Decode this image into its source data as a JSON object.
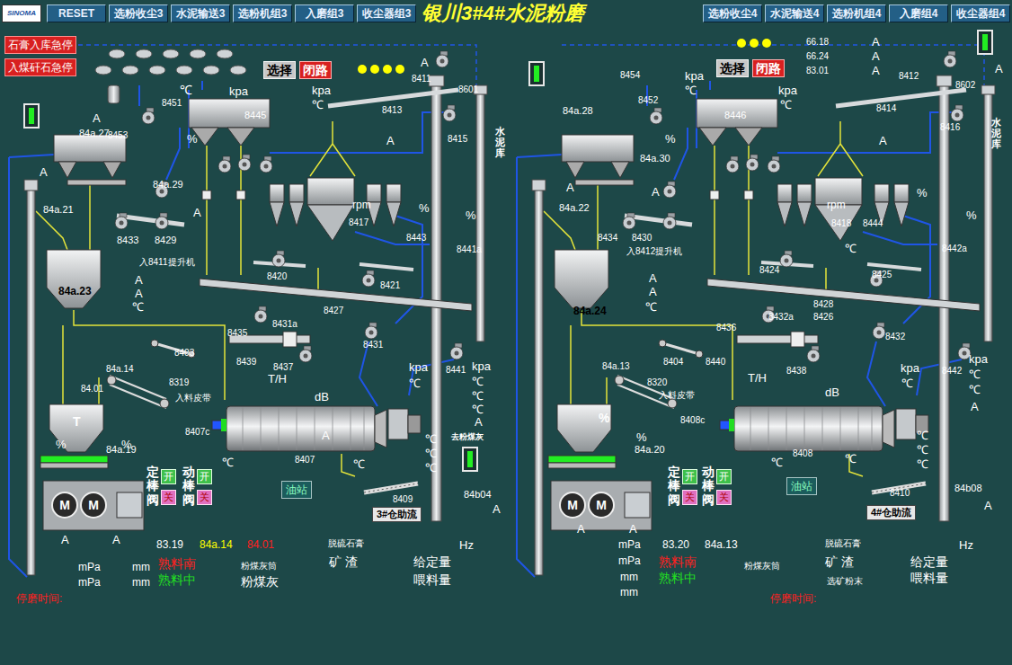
{
  "window": {
    "title": "银川3#4#水泥粉磨",
    "logo": "SINOMA"
  },
  "toolbar": {
    "reset": "RESET",
    "left": [
      "选粉收尘3",
      "水泥输送3",
      "选粉机组3",
      "入磨组3",
      "收尘器组3"
    ],
    "right": [
      "选粉收尘4",
      "水泥输送4",
      "选粉机组4",
      "入磨组4",
      "收尘器组4"
    ]
  },
  "emergency_stops": [
    "石膏入库急停",
    "入煤矸石急停"
  ],
  "run_indicators": [
    {
      "on": true
    },
    {
      "on": true
    },
    {
      "on": true
    },
    {
      "on": true
    }
  ],
  "mills": [
    {
      "mode_buttons": [
        {
          "label": "选择",
          "selected": false
        },
        {
          "label": "闭路",
          "selected": true
        }
      ],
      "lamps": [
        {
          "on": true
        },
        {
          "on": true
        },
        {
          "on": true
        },
        {
          "on": true
        }
      ],
      "press_motors": [
        "M",
        "M"
      ],
      "valves": [
        {
          "name": "定棒阀",
          "open": "开",
          "close": "关"
        },
        {
          "name": "动棒阀",
          "open": "开",
          "close": "关"
        }
      ],
      "labels": [
        {
          "text": "84a.27"
        },
        {
          "text": "A"
        },
        {
          "text": "84a.29"
        },
        {
          "text": "8451"
        },
        {
          "text": "A"
        },
        {
          "text": "8453"
        },
        {
          "text": "℃"
        },
        {
          "text": "kpa"
        },
        {
          "text": "%"
        },
        {
          "text": "8445"
        },
        {
          "text": "A"
        },
        {
          "text": "84a.21"
        },
        {
          "text": "8433"
        },
        {
          "text": "8429"
        },
        {
          "text": "入8411提升机"
        },
        {
          "text": "84a.23",
          "color": "#000000",
          "kind": "bold"
        },
        {
          "text": "A"
        },
        {
          "text": "A"
        },
        {
          "text": "℃"
        },
        {
          "text": "A"
        },
        {
          "text": "8411"
        },
        {
          "text": "8601"
        },
        {
          "text": "8413"
        },
        {
          "text": "kpa"
        },
        {
          "text": "℃"
        },
        {
          "text": "8415"
        },
        {
          "text": "A"
        },
        {
          "text": "水泥库",
          "kind": "vertical"
        },
        {
          "text": "rpm"
        },
        {
          "text": "8417"
        },
        {
          "text": "%"
        },
        {
          "text": "8443"
        },
        {
          "text": "8441a"
        },
        {
          "text": "%"
        },
        {
          "text": "8420"
        },
        {
          "text": "8421"
        },
        {
          "text": "8427"
        },
        {
          "text": "8431a"
        },
        {
          "text": "8435"
        },
        {
          "text": "8431"
        },
        {
          "text": "8403"
        },
        {
          "text": "8439"
        },
        {
          "text": "8437"
        },
        {
          "text": "T/H"
        },
        {
          "text": "84a.14"
        },
        {
          "text": "84.01"
        },
        {
          "text": "8319"
        },
        {
          "text": "入料皮带"
        },
        {
          "text": "8441"
        },
        {
          "text": "kpa"
        },
        {
          "text": "℃"
        },
        {
          "text": "℃"
        },
        {
          "text": "℃"
        },
        {
          "text": "A"
        },
        {
          "text": "kpa"
        },
        {
          "text": "℃"
        },
        {
          "text": "dB"
        },
        {
          "text": "A"
        },
        {
          "text": "T",
          "kind": "bold"
        },
        {
          "text": "%"
        },
        {
          "text": "%"
        },
        {
          "text": "8407c"
        },
        {
          "text": "8407"
        },
        {
          "text": "℃"
        },
        {
          "text": "℃"
        },
        {
          "text": "84a.19"
        },
        {
          "text": "A"
        },
        {
          "text": "A"
        },
        {
          "text": "℃"
        },
        {
          "text": "℃"
        },
        {
          "text": "℃"
        },
        {
          "text": "油站",
          "kind": "box"
        },
        {
          "text": "8409"
        },
        {
          "text": "3#仓助流",
          "kind": "box-light"
        },
        {
          "text": "84b04"
        },
        {
          "text": "A"
        },
        {
          "text": "去粉煤灰",
          "kind": "bold"
        },
        {
          "text": "Hz"
        },
        {
          "text": "83.19"
        },
        {
          "text": "84a.14",
          "color": "#ffff00"
        },
        {
          "text": "84.01",
          "color": "#ff2020"
        },
        {
          "text": "脱硫石膏"
        },
        {
          "text": "mPa"
        },
        {
          "text": "mm"
        },
        {
          "text": "熟料南",
          "color": "#ff2020"
        },
        {
          "text": "粉煤灰筒"
        },
        {
          "text": "矿 渣"
        },
        {
          "text": "给定量"
        },
        {
          "text": "mPa"
        },
        {
          "text": "mm"
        },
        {
          "text": "熟料中",
          "color": "#22dd22"
        },
        {
          "text": "粉煤灰"
        },
        {
          "text": "喂料量"
        },
        {
          "text": "停磨时间:",
          "color": "#ff2020"
        }
      ]
    },
    {
      "mode_buttons": [
        {
          "label": "选择",
          "selected": false
        },
        {
          "label": "闭路",
          "selected": true
        }
      ],
      "lamps": [
        {
          "on": true
        },
        {
          "on": true
        },
        {
          "on": true
        }
      ],
      "press_motors": [
        "M",
        "M"
      ],
      "valves": [
        {
          "name": "定棒阀",
          "open": "开",
          "close": "关"
        },
        {
          "name": "动棒阀",
          "open": "开",
          "close": "关"
        }
      ],
      "labels": [
        {
          "text": "84a.28"
        },
        {
          "text": "8454"
        },
        {
          "text": "8452"
        },
        {
          "text": "kpa"
        },
        {
          "text": "℃"
        },
        {
          "text": "%"
        },
        {
          "text": "84a.30"
        },
        {
          "text": "8446"
        },
        {
          "text": "kpa"
        },
        {
          "text": "℃"
        },
        {
          "text": "66.18"
        },
        {
          "text": "A"
        },
        {
          "text": "66.24"
        },
        {
          "text": "A"
        },
        {
          "text": "83.01"
        },
        {
          "text": "A"
        },
        {
          "text": "A"
        },
        {
          "text": "8412"
        },
        {
          "text": "8602"
        },
        {
          "text": "8414"
        },
        {
          "text": "8416"
        },
        {
          "text": "A"
        },
        {
          "text": "水泥库",
          "kind": "vertical"
        },
        {
          "text": "A"
        },
        {
          "text": "A"
        },
        {
          "text": "84a.22"
        },
        {
          "text": "8434"
        },
        {
          "text": "8430"
        },
        {
          "text": "入8412提升机"
        },
        {
          "text": "A"
        },
        {
          "text": "A"
        },
        {
          "text": "℃"
        },
        {
          "text": "84a.24",
          "color": "#000000",
          "kind": "bold"
        },
        {
          "text": "rpm"
        },
        {
          "text": "8418"
        },
        {
          "text": "8444"
        },
        {
          "text": "%"
        },
        {
          "text": "8442a"
        },
        {
          "text": "%"
        },
        {
          "text": "℃"
        },
        {
          "text": "8424"
        },
        {
          "text": "8425"
        },
        {
          "text": "8428"
        },
        {
          "text": "8426"
        },
        {
          "text": "8432a"
        },
        {
          "text": "8436"
        },
        {
          "text": "8432"
        },
        {
          "text": "8404"
        },
        {
          "text": "8440"
        },
        {
          "text": "8438"
        },
        {
          "text": "T/H"
        },
        {
          "text": "84a.13"
        },
        {
          "text": "8320"
        },
        {
          "text": "入料皮带"
        },
        {
          "text": "kpa"
        },
        {
          "text": "℃"
        },
        {
          "text": "8442"
        },
        {
          "text": "kpa"
        },
        {
          "text": "℃"
        },
        {
          "text": "℃"
        },
        {
          "text": "A"
        },
        {
          "text": "dB"
        },
        {
          "text": "%",
          "kind": "bold"
        },
        {
          "text": "%"
        },
        {
          "text": "84a.20"
        },
        {
          "text": "8408c"
        },
        {
          "text": "8408"
        },
        {
          "text": "℃"
        },
        {
          "text": "℃"
        },
        {
          "text": "℃"
        },
        {
          "text": "℃"
        },
        {
          "text": "℃"
        },
        {
          "text": "油站",
          "kind": "box"
        },
        {
          "text": "8410"
        },
        {
          "text": "4#仓助流",
          "kind": "box-light"
        },
        {
          "text": "84b08"
        },
        {
          "text": "A"
        },
        {
          "text": "A"
        },
        {
          "text": "A"
        },
        {
          "text": "Hz"
        },
        {
          "text": "mPa"
        },
        {
          "text": "83.20"
        },
        {
          "text": "84a.13"
        },
        {
          "text": "脱硫石膏"
        },
        {
          "text": "mPa"
        },
        {
          "text": "熟料南",
          "color": "#ff2020"
        },
        {
          "text": "粉煤灰筒"
        },
        {
          "text": "矿 渣"
        },
        {
          "text": "给定量"
        },
        {
          "text": "mm"
        },
        {
          "text": "熟料中",
          "color": "#22dd22"
        },
        {
          "text": "选矿粉末"
        },
        {
          "text": "喂料量"
        },
        {
          "text": "mm"
        },
        {
          "text": "停磨时间:",
          "color": "#ff2020"
        }
      ]
    }
  ]
}
